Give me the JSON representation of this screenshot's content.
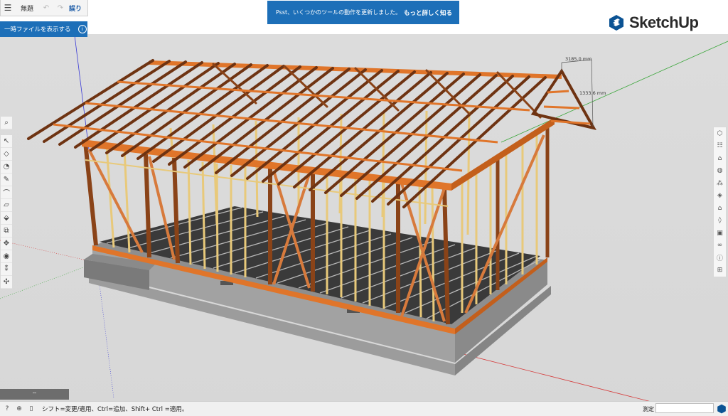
{
  "app": {
    "brand": "SketchUp",
    "brand_color": "#0b5394"
  },
  "toolbar": {
    "menu_icon": "hamburger-icon",
    "file_title": "無題",
    "undo_icon": "undo-icon",
    "redo_icon": "redo-icon",
    "incorrect_label": "誤り"
  },
  "temp_banner": {
    "label": "一時ファイルを表示する",
    "info_icon": "info-icon",
    "bg": "#1d6fb8"
  },
  "notification": {
    "text": "Psst、いくつかのツールの動作を更新しました。",
    "link_label": "もっと詳しく知る",
    "bg": "#1d6fb8"
  },
  "left_tools": [
    {
      "name": "search-tool",
      "icon": "search-icon"
    },
    {
      "name": "select-tool",
      "icon": "arrow-icon"
    },
    {
      "name": "eraser-tool",
      "icon": "eraser-icon"
    },
    {
      "name": "paint-tool",
      "icon": "paint-bucket-icon"
    },
    {
      "name": "pencil-tool",
      "icon": "pencil-icon"
    },
    {
      "name": "arc-tool",
      "icon": "arc-icon"
    },
    {
      "name": "rectangle-tool",
      "icon": "rectangle-icon"
    },
    {
      "name": "pushpull-tool",
      "icon": "push-pull-icon"
    },
    {
      "name": "offset-tool",
      "icon": "offset-icon"
    },
    {
      "name": "move-tool",
      "icon": "move-icon"
    },
    {
      "name": "tape-tool",
      "icon": "tape-measure-icon"
    },
    {
      "name": "walk-tool",
      "icon": "footprints-icon"
    },
    {
      "name": "orbit-tool",
      "icon": "orbit-icon"
    }
  ],
  "right_tools": [
    {
      "name": "entity-info",
      "icon": "cube-icon"
    },
    {
      "name": "outliner",
      "icon": "outliner-icon"
    },
    {
      "name": "instructor",
      "icon": "grad-cap-icon"
    },
    {
      "name": "materials",
      "icon": "materials-icon"
    },
    {
      "name": "components",
      "icon": "components-icon"
    },
    {
      "name": "styles",
      "icon": "styles-icon"
    },
    {
      "name": "scenes",
      "icon": "scenes-icon"
    },
    {
      "name": "tags",
      "icon": "tag-icon"
    },
    {
      "name": "shadows",
      "icon": "shadows-icon"
    },
    {
      "name": "display",
      "icon": "glasses-icon"
    },
    {
      "name": "info",
      "icon": "info-icon"
    },
    {
      "name": "extensions",
      "icon": "extension-icon"
    }
  ],
  "dimensions": {
    "length_label": "3185.0 mm",
    "height_label": "1333.6 mm"
  },
  "status_bar": {
    "hint": "シフト=変更/適用、Ctrl=追加、Shift+ Ctrl =適用。",
    "measure_label": "測定",
    "measure_value": ""
  },
  "colors": {
    "timber": "#e0752a",
    "timber_dark": "#7a3a14",
    "stud_light": "#e8c97a",
    "concrete": "#9f9f9f",
    "axis_red": "#d63a3a",
    "axis_green": "#3aa63a",
    "axis_blue": "#3a3ad6"
  }
}
